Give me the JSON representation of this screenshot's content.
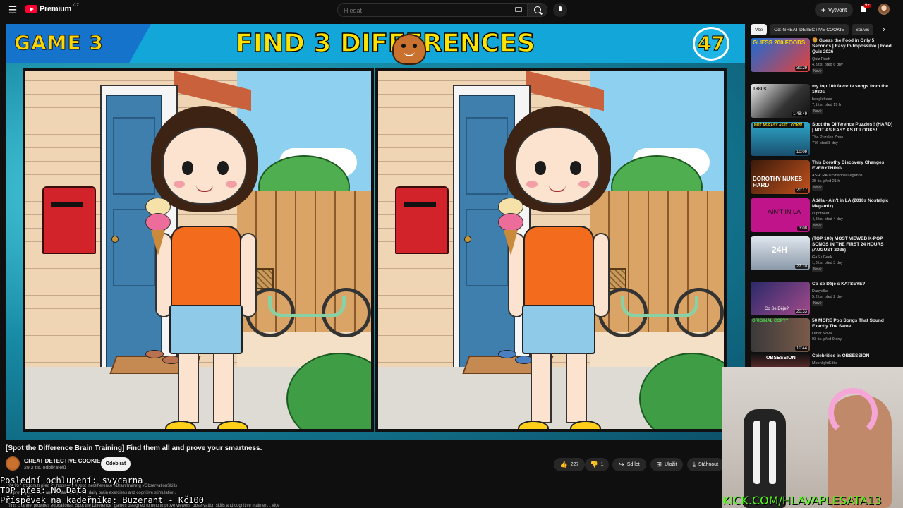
{
  "header": {
    "logo_text": "Premium",
    "logo_region": "CZ",
    "search_placeholder": "Hledat",
    "create_label": "Vytvořit",
    "notification_count": "9+"
  },
  "video": {
    "game_label": "GAME 3",
    "title_banner": "FIND 3 DIFFERENCES",
    "timer": "47",
    "title": "[Spot the Difference Brain Training] Find them all and prove your smartness.",
    "channel": "GREAT DETECTIVE COOKIE",
    "subscribers": "29,2 tis. odběratelů",
    "subscribe_label": "Odebírat",
    "likes": "227",
    "dislikes": "1",
    "share_label": "Sdílet",
    "save_label": "Uložit",
    "download_label": "Stáhnout",
    "description_1": "24 957 zhlédnutí  před 21 hodinami  #SpotTheDifference #BrainTraining #ObservationSkills",
    "description_2": "Improve your focus and mental clarity with daily brain exercises and cognitive stimulation.",
    "description_3": "This channel provides educational \"Spot the Difference\" games designed to help improve viewers' observation skills and cognitive mainten... více"
  },
  "overlays": {
    "line1": "Poslední ochlupení: svycarna",
    "line2": "TOP přes: No Data",
    "line3": "Příspěvek na kadeřníka: Buzerant - Kč100",
    "kick": "KICK.COM/HLAVAPLESATA13"
  },
  "sidebar": {
    "chips": [
      "Vše",
      "Od: GREAT DETECTIVE COOKIE",
      "Souvis"
    ],
    "items": [
      {
        "title": "🍔 Guess the Food in Only 5 Seconds | Easy to Impossible | Food Quiz 2026",
        "channel": "Quiz Rush",
        "meta": "4,3 tis.  před 6 dny",
        "badge": "Nový",
        "duration": "30:29",
        "thumb_text": "GUESS 200 FOODS"
      },
      {
        "title": "my top 100 favorite songs from the 1980s",
        "channel": "booglehead",
        "meta": "7,1 tis.  před 19 h",
        "badge": "Nový",
        "duration": "1:48:49",
        "thumb_text": "1980s"
      },
      {
        "title": "Spot the Difference Puzzles ! (HARD) | NOT AS EASY AS IT LOOKS!",
        "channel": "The Puzzles Zone",
        "meta": "776  před 8 dny",
        "badge": "",
        "duration": "10:09",
        "thumb_text": "NOT AS EASY AS IT LOOKS!"
      },
      {
        "title": "This Dorothy Discovery Changes EVERYTHING",
        "channel": "ASH: RAID Shadow Legends",
        "meta": "35 tis.  před 21 h",
        "badge": "Nový",
        "duration": "20:17",
        "thumb_text": "DOROTHY NUKES HARD"
      },
      {
        "title": "Adéla - Ain't in LA (2010s Nostalgic Megamix)",
        "channel": "cupofbeer",
        "meta": "4,8 tis.  před 4 dny",
        "badge": "Nový",
        "duration": "3:08",
        "thumb_text": "AIN'T IN LA"
      },
      {
        "title": "(TOP 100) MOST VIEWED K-POP SONGS IN THE FIRST 24 HOURS (AUGUST 2026)",
        "channel": "GaSu Geek",
        "meta": "1,3 tis.  před 3 dny",
        "badge": "Nový",
        "duration": "27:10",
        "thumb_text": "24H"
      },
      {
        "title": "Co Se Děje s KATSEYE?",
        "channel": "Danyelka",
        "meta": "5,2 tis.  před 2 dny",
        "badge": "Nový",
        "duration": "20:33",
        "thumb_text": "Co Se Děje?"
      },
      {
        "title": "50 MORE Pop Songs That Sound Exactly The Same",
        "channel": "Omar Nova",
        "meta": "93 tis.  před 9 dny",
        "badge": "",
        "duration": "10:44",
        "thumb_text": "ORIGINAL  COPY?"
      },
      {
        "title": "Celebrities in OBSESSION",
        "channel": "MoonlightEdits",
        "meta": "",
        "badge": "",
        "duration": "",
        "thumb_text": "OBSESSION"
      }
    ]
  },
  "colors": {
    "accent_red": "#ff0033",
    "kick_green": "#53fc18",
    "banner_yellow": "#ffe200"
  }
}
